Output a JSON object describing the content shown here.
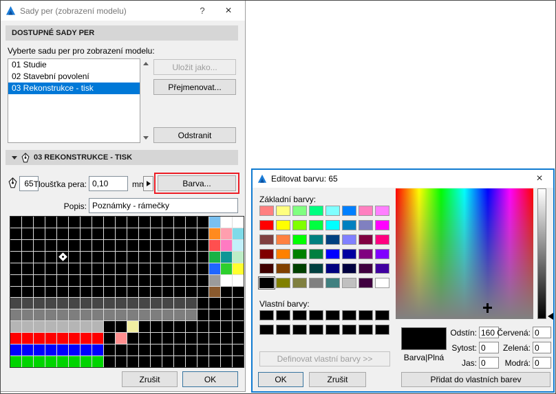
{
  "left_dialog": {
    "title": "Sady per (zobrazení modelu)",
    "controls": {
      "help": "?",
      "close": "×"
    },
    "section_available": "DOSTUPNÉ SADY PER",
    "select_label": "Vyberte sadu per pro zobrazení modelu:",
    "pen_sets": [
      "01 Studie",
      "02 Stavební povolení",
      "03 Rekonstrukce - tisk"
    ],
    "selected_index": 2,
    "buttons": {
      "save_as": "Uložit jako...",
      "rename": "Přejmenovat...",
      "delete": "Odstranit",
      "color": "Barva...",
      "cancel": "Zrušit",
      "ok": "OK"
    },
    "section_current": "03 REKONSTRUKCE - TISK",
    "pen_number": "65",
    "thickness_label": "Tloušťka pera:",
    "thickness_value": "0,10",
    "unit_label": "mm",
    "desc_label": "Popis:",
    "desc_value": "Poznámky - rámečky",
    "pen_grid": {
      "cols": 20,
      "selected": {
        "row": 3,
        "col": 4
      },
      "rows": [
        [
          "#000000",
          "#000000",
          "#000000",
          "#000000",
          "#000000",
          "#000000",
          "#000000",
          "#000000",
          "#000000",
          "#000000",
          "#000000",
          "#000000",
          "#000000",
          "#000000",
          "#000000",
          "#000000",
          "#000000",
          "#79c0f0",
          "#ffffff",
          "#ffffff"
        ],
        [
          "#000000",
          "#000000",
          "#000000",
          "#000000",
          "#000000",
          "#000000",
          "#000000",
          "#000000",
          "#000000",
          "#000000",
          "#000000",
          "#000000",
          "#000000",
          "#000000",
          "#000000",
          "#000000",
          "#000000",
          "#ff8a1e",
          "#ff9fae",
          "#7fdbe8"
        ],
        [
          "#000000",
          "#000000",
          "#000000",
          "#000000",
          "#000000",
          "#000000",
          "#000000",
          "#000000",
          "#000000",
          "#000000",
          "#000000",
          "#000000",
          "#000000",
          "#000000",
          "#000000",
          "#000000",
          "#000000",
          "#ff4f4f",
          "#ff7ac2",
          "#c2f0fa"
        ],
        [
          "#000000",
          "#000000",
          "#000000",
          "#000000",
          "#000000",
          "#000000",
          "#000000",
          "#000000",
          "#000000",
          "#000000",
          "#000000",
          "#000000",
          "#000000",
          "#000000",
          "#000000",
          "#000000",
          "#000000",
          "#19b245",
          "#0f9696",
          "#bdeec6"
        ],
        [
          "#000000",
          "#000000",
          "#000000",
          "#000000",
          "#000000",
          "#000000",
          "#000000",
          "#000000",
          "#000000",
          "#000000",
          "#000000",
          "#000000",
          "#000000",
          "#000000",
          "#000000",
          "#000000",
          "#000000",
          "#1f66ff",
          "#2dcf2d",
          "#ffff2e"
        ],
        [
          "#000000",
          "#000000",
          "#000000",
          "#000000",
          "#000000",
          "#000000",
          "#000000",
          "#000000",
          "#000000",
          "#000000",
          "#000000",
          "#000000",
          "#000000",
          "#000000",
          "#000000",
          "#000000",
          "#000000",
          "#9b9b9b",
          "#ffffff",
          "#ffffff"
        ],
        [
          "#000000",
          "#000000",
          "#000000",
          "#000000",
          "#000000",
          "#000000",
          "#000000",
          "#000000",
          "#000000",
          "#000000",
          "#000000",
          "#000000",
          "#000000",
          "#000000",
          "#000000",
          "#000000",
          "#000000",
          "#8a5a2e",
          "#000000",
          "#000000"
        ],
        [
          "#464646",
          "#464646",
          "#464646",
          "#464646",
          "#464646",
          "#464646",
          "#464646",
          "#464646",
          "#464646",
          "#464646",
          "#464646",
          "#464646",
          "#464646",
          "#464646",
          "#464646",
          "#464646",
          "#000000",
          "#000000",
          "#000000",
          "#000000"
        ],
        [
          "#7e7e7e",
          "#7e7e7e",
          "#7e7e7e",
          "#7e7e7e",
          "#7e7e7e",
          "#7e7e7e",
          "#7e7e7e",
          "#7e7e7e",
          "#7e7e7e",
          "#7e7e7e",
          "#7e7e7e",
          "#7e7e7e",
          "#7e7e7e",
          "#7e7e7e",
          "#7e7e7e",
          "#7e7e7e",
          "#000000",
          "#000000",
          "#000000",
          "#000000"
        ],
        [
          "#b5b5b5",
          "#b5b5b5",
          "#b5b5b5",
          "#b5b5b5",
          "#b5b5b5",
          "#b5b5b5",
          "#b5b5b5",
          "#b5b5b5",
          "#000000",
          "#000000",
          "#f1eea2",
          "#000000",
          "#000000",
          "#000000",
          "#000000",
          "#000000",
          "#000000",
          "#000000",
          "#000000",
          "#000000"
        ],
        [
          "#fe0000",
          "#fe0000",
          "#fe0000",
          "#fe0000",
          "#fe0000",
          "#fe0000",
          "#fe0000",
          "#fe0000",
          "#000000",
          "#ff8f8f",
          "#000000",
          "#000000",
          "#000000",
          "#000000",
          "#000000",
          "#000000",
          "#000000",
          "#000000",
          "#000000",
          "#000000"
        ],
        [
          "#0000fe",
          "#0000fe",
          "#0000fe",
          "#0000fe",
          "#0000fe",
          "#0000fe",
          "#0000fe",
          "#0000fe",
          "#000000",
          "#000000",
          "#000000",
          "#000000",
          "#000000",
          "#000000",
          "#000000",
          "#000000",
          "#000000",
          "#000000",
          "#000000",
          "#000000"
        ],
        [
          "#00d400",
          "#00d400",
          "#00d400",
          "#00d400",
          "#00d400",
          "#00d400",
          "#00d400",
          "#00d400",
          "#000000",
          "#000000",
          "#000000",
          "#000000",
          "#000000",
          "#000000",
          "#000000",
          "#000000",
          "#000000",
          "#000000",
          "#000000",
          "#000000"
        ]
      ]
    }
  },
  "color_dialog": {
    "title": "Editovat barvu: 65",
    "controls": {
      "close": "×"
    },
    "basic_label": "Základní barvy:",
    "basic_colors": [
      "#FF8080",
      "#FFFF80",
      "#80FF80",
      "#00FF80",
      "#80FFFF",
      "#0080FF",
      "#FF80C0",
      "#FF80FF",
      "#FF0000",
      "#FFFF00",
      "#80FF00",
      "#00FF40",
      "#00FFFF",
      "#0080C0",
      "#8080C0",
      "#FF00FF",
      "#804040",
      "#FF8040",
      "#00FF00",
      "#008080",
      "#004080",
      "#8080FF",
      "#800040",
      "#FF0080",
      "#800000",
      "#FF8000",
      "#008000",
      "#008040",
      "#0000FF",
      "#0000A0",
      "#800080",
      "#8000FF",
      "#400000",
      "#804000",
      "#004000",
      "#004040",
      "#000080",
      "#000040",
      "#400040",
      "#4000A0",
      "#000000",
      "#808000",
      "#808040",
      "#808080",
      "#408080",
      "#C0C0C0",
      "#400040",
      "#FFFFFF"
    ],
    "selected_basic_index": 40,
    "custom_label": "Vlastní barvy:",
    "custom_colors": [
      "#000000",
      "#000000",
      "#000000",
      "#000000",
      "#000000",
      "#000000",
      "#000000",
      "#000000",
      "#000000",
      "#000000",
      "#000000",
      "#000000",
      "#000000",
      "#000000",
      "#000000",
      "#000000"
    ],
    "define_custom_label": "Definovat vlastní barvy >>",
    "ok_label": "OK",
    "cancel_label": "Zrušit",
    "add_custom_label": "Přidat do vlastních barev",
    "preview_color": "#000000",
    "preview_label": "Barva|Plná",
    "fields": [
      {
        "label": "Odstín:",
        "value": "160"
      },
      {
        "label": "Sytost:",
        "value": "0"
      },
      {
        "label": "Jas:",
        "value": "0"
      },
      {
        "label": "Červená:",
        "value": "0"
      },
      {
        "label": "Zelená:",
        "value": "0"
      },
      {
        "label": "Modrá:",
        "value": "0"
      }
    ]
  }
}
